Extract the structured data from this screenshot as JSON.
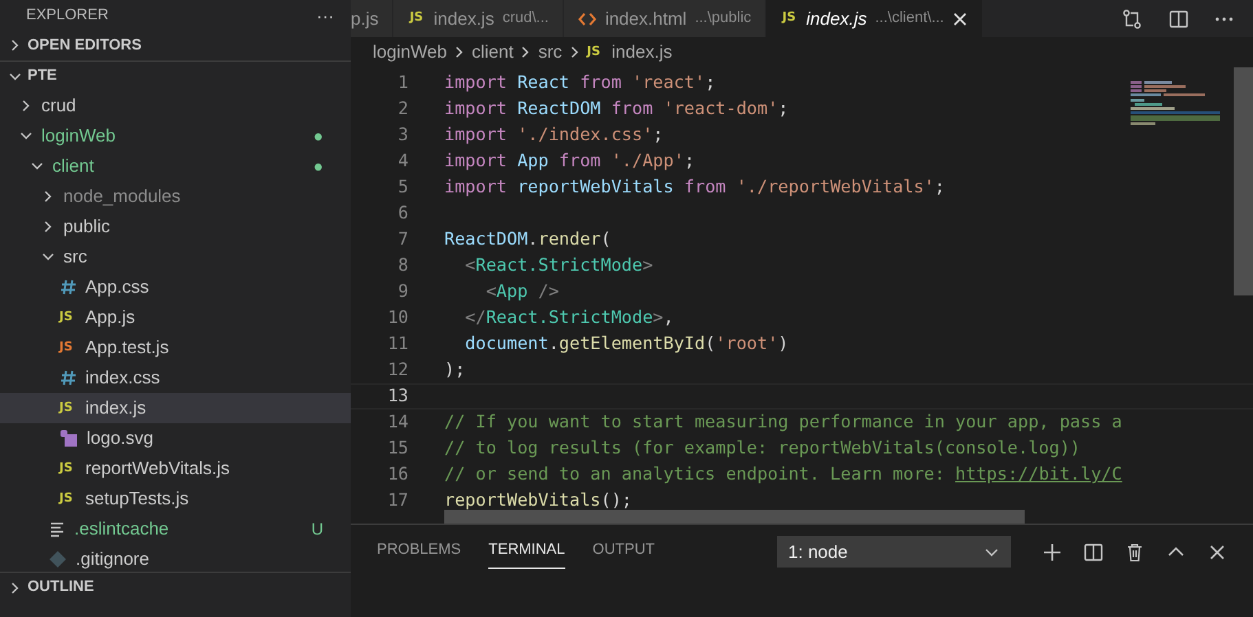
{
  "sidebar": {
    "title": "EXPLORER",
    "more": "···",
    "sections": [
      {
        "label": "OPEN EDITORS",
        "expanded": false
      },
      {
        "label": "PTE",
        "expanded": true
      },
      {
        "label": "OUTLINE",
        "expanded": false
      }
    ],
    "tree": [
      {
        "label": "crud",
        "kind": "folder",
        "expanded": false,
        "selected": false
      },
      {
        "label": "loginWeb",
        "kind": "folder",
        "expanded": true,
        "selected": false,
        "color": "#73c991",
        "badge": "●",
        "children": [
          {
            "label": "client",
            "kind": "folder",
            "expanded": true,
            "selected": false,
            "color": "#73c991",
            "badge": "●",
            "children": [
              {
                "label": "node_modules",
                "kind": "folder",
                "expanded": false,
                "selected": false,
                "color": "#8c8c8c"
              },
              {
                "label": "public",
                "kind": "folder",
                "expanded": false,
                "selected": false
              },
              {
                "label": "src",
                "kind": "folder",
                "expanded": true,
                "selected": false,
                "children": [
                  {
                    "label": "App.css",
                    "kind": "css",
                    "selected": false
                  },
                  {
                    "label": "App.js",
                    "kind": "js",
                    "icon_text": "JS",
                    "selected": false
                  },
                  {
                    "label": "App.test.js",
                    "kind": "test",
                    "icon_text": "JS",
                    "selected": false
                  },
                  {
                    "label": "index.css",
                    "kind": "css",
                    "selected": false
                  },
                  {
                    "label": "index.js",
                    "kind": "js",
                    "icon_text": "JS",
                    "selected": true
                  },
                  {
                    "label": "logo.svg",
                    "kind": "svg",
                    "selected": false
                  },
                  {
                    "label": "reportWebVitals.js",
                    "kind": "js",
                    "icon_text": "JS",
                    "selected": false
                  },
                  {
                    "label": "setupTests.js",
                    "kind": "js",
                    "icon_text": "JS",
                    "selected": false
                  }
                ]
              },
              {
                "label": ".eslintcache",
                "kind": "lines",
                "selected": false,
                "color": "#73c991",
                "badge": "U"
              },
              {
                "label": ".gitignore",
                "kind": "git",
                "selected": false
              }
            ]
          }
        ]
      }
    ]
  },
  "tabs": [
    {
      "label": "p.js",
      "selected": false
    },
    {
      "label": "index.js",
      "detail": "crud\\...",
      "kind": "js",
      "icon_text": "JS",
      "selected": false
    },
    {
      "label": "index.html",
      "detail": "...\\public",
      "kind": "html",
      "selected": false
    },
    {
      "label": "index.js",
      "detail": "...\\client\\...",
      "kind": "js",
      "icon_text": "JS",
      "selected": true
    }
  ],
  "breadcrumb": [
    {
      "label": "loginWeb"
    },
    {
      "label": "client"
    },
    {
      "label": "src"
    },
    {
      "label": "index.js",
      "kind": "js",
      "icon_text": "JS"
    }
  ],
  "code": [
    {
      "number": "1",
      "tokens": [
        {
          "t": "import",
          "color": "#c586c0"
        },
        {
          "t": " React ",
          "color": "#9cdcfe"
        },
        {
          "t": "from",
          "color": "#c586c0"
        },
        {
          "t": " 'react'",
          "color": "#ce9178"
        },
        {
          "t": ";",
          "color": "#d4d4d4"
        }
      ]
    },
    {
      "number": "2",
      "tokens": [
        {
          "t": "import",
          "color": "#c586c0"
        },
        {
          "t": " ReactDOM ",
          "color": "#9cdcfe"
        },
        {
          "t": "from",
          "color": "#c586c0"
        },
        {
          "t": " 'react-dom'",
          "color": "#ce9178"
        },
        {
          "t": ";",
          "color": "#d4d4d4"
        }
      ]
    },
    {
      "number": "3",
      "tokens": [
        {
          "t": "import",
          "color": "#c586c0"
        },
        {
          "t": " './index.css'",
          "color": "#ce9178"
        },
        {
          "t": ";",
          "color": "#d4d4d4"
        }
      ]
    },
    {
      "number": "4",
      "tokens": [
        {
          "t": "import",
          "color": "#c586c0"
        },
        {
          "t": " App ",
          "color": "#9cdcfe"
        },
        {
          "t": "from",
          "color": "#c586c0"
        },
        {
          "t": " './App'",
          "color": "#ce9178"
        },
        {
          "t": ";",
          "color": "#d4d4d4"
        }
      ]
    },
    {
      "number": "5",
      "tokens": [
        {
          "t": "import",
          "color": "#c586c0"
        },
        {
          "t": " reportWebVitals ",
          "color": "#9cdcfe"
        },
        {
          "t": "from",
          "color": "#c586c0"
        },
        {
          "t": " './reportWebVitals'",
          "color": "#ce9178"
        },
        {
          "t": ";",
          "color": "#d4d4d4"
        }
      ]
    },
    {
      "number": "6"
    },
    {
      "number": "7",
      "tokens": [
        {
          "t": "ReactDOM",
          "color": "#9cdcfe"
        },
        {
          "t": ".",
          "color": "#d4d4d4"
        },
        {
          "t": "render",
          "color": "#dcdcaa"
        },
        {
          "t": "(",
          "color": "#d4d4d4"
        }
      ]
    },
    {
      "number": "8",
      "tokens": [
        {
          "t": "  <",
          "color": "#808080"
        },
        {
          "t": "React.StrictMode",
          "color": "#4ec9b0"
        },
        {
          "t": ">",
          "color": "#808080"
        }
      ]
    },
    {
      "number": "9",
      "tokens": [
        {
          "t": "    <",
          "color": "#808080"
        },
        {
          "t": "App",
          "color": "#4ec9b0"
        },
        {
          "t": " />",
          "color": "#808080"
        }
      ]
    },
    {
      "number": "10",
      "tokens": [
        {
          "t": "  </",
          "color": "#808080"
        },
        {
          "t": "React.StrictMode",
          "color": "#4ec9b0"
        },
        {
          "t": ">",
          "color": "#808080"
        },
        {
          "t": ",",
          "color": "#d4d4d4"
        }
      ]
    },
    {
      "number": "11",
      "tokens": [
        {
          "t": "  document",
          "color": "#9cdcfe"
        },
        {
          "t": ".",
          "color": "#d4d4d4"
        },
        {
          "t": "getElementById",
          "color": "#dcdcaa"
        },
        {
          "t": "(",
          "color": "#d4d4d4"
        },
        {
          "t": "'root'",
          "color": "#ce9178"
        },
        {
          "t": ")",
          "color": "#d4d4d4"
        }
      ]
    },
    {
      "number": "12",
      "tokens": [
        {
          "t": ");",
          "color": "#d4d4d4"
        }
      ]
    },
    {
      "number": "13",
      "current": true
    },
    {
      "number": "14",
      "tokens": [
        {
          "t": "// If you want to start measuring performance in your app, pass a",
          "color": "#6a9955"
        }
      ]
    },
    {
      "number": "15",
      "tokens": [
        {
          "t": "// to log results (for example: reportWebVitals(console.log))",
          "color": "#6a9955"
        }
      ]
    },
    {
      "number": "16",
      "tokens": [
        {
          "t": "// or send to an analytics endpoint. Learn more: ",
          "color": "#6a9955"
        },
        {
          "t": "https://bit.ly/C",
          "color": "#6a9955",
          "link": true
        }
      ]
    },
    {
      "number": "17",
      "tokens": [
        {
          "t": "reportWebVitals",
          "color": "#dcdcaa"
        },
        {
          "t": "();",
          "color": "#d4d4d4"
        }
      ]
    }
  ],
  "panel": {
    "tabs": [
      {
        "label": "PROBLEMS",
        "selected": false
      },
      {
        "label": "TERMINAL",
        "selected": true
      },
      {
        "label": "OUTPUT",
        "selected": false
      }
    ],
    "terminal_select": "1: node"
  }
}
